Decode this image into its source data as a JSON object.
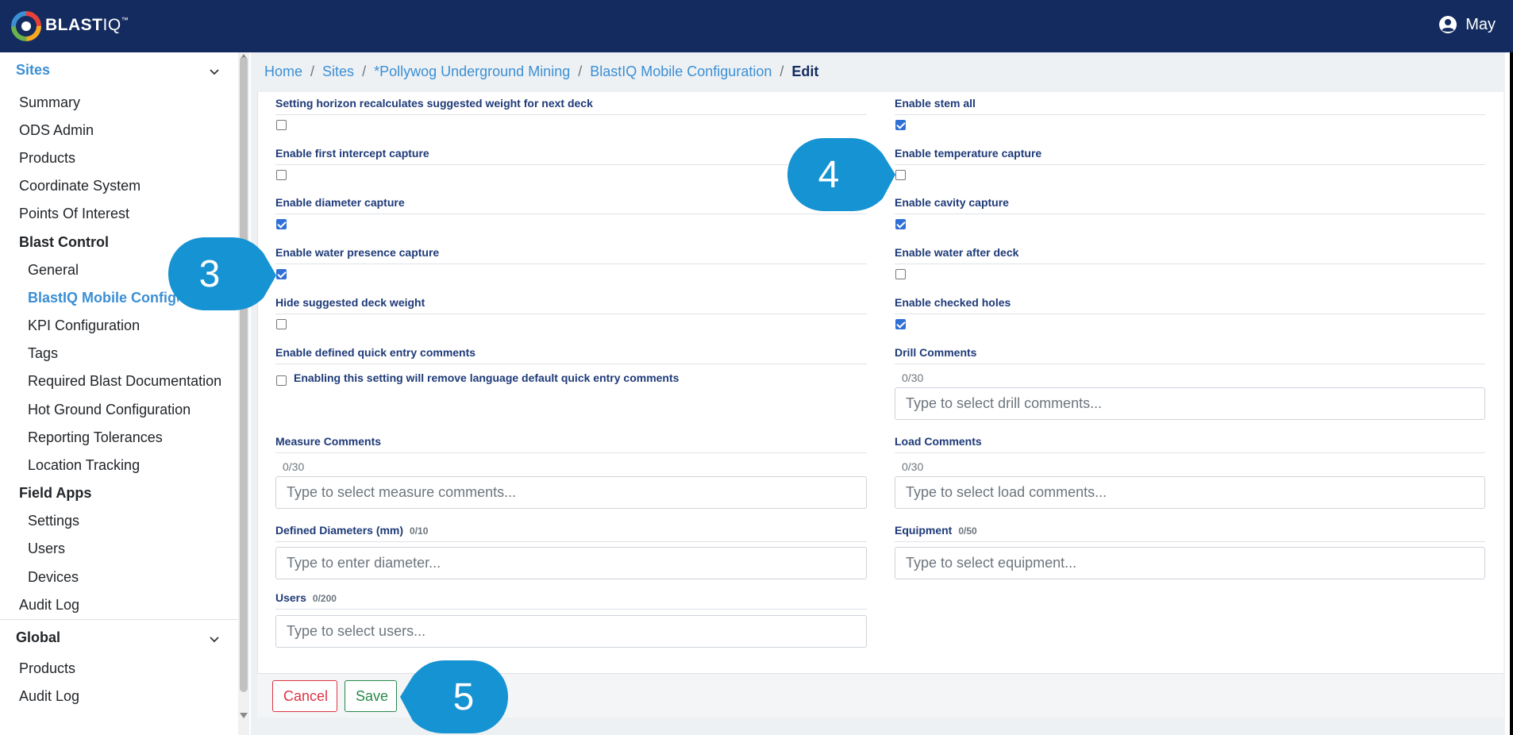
{
  "header": {
    "brand_bold": "BLAST",
    "brand_light": "IQ",
    "brand_tm": "™",
    "user_name": "May"
  },
  "sidebar": {
    "sites_title": "Sites",
    "sites_items": [
      "Summary",
      "ODS Admin",
      "Products",
      "Coordinate System",
      "Points Of Interest"
    ],
    "blast_control": "Blast Control",
    "blast_items": [
      "General",
      "BlastIQ Mobile Configuration",
      "KPI Configuration",
      "Tags",
      "Required Blast Documentation",
      "Hot Ground Configuration",
      "Reporting Tolerances",
      "Location Tracking"
    ],
    "field_apps": "Field Apps",
    "field_items": [
      "Settings",
      "Users",
      "Devices"
    ],
    "audit_log": "Audit Log",
    "global_title": "Global",
    "global_items": [
      "Products",
      "Audit Log"
    ]
  },
  "breadcrumb": [
    "Home",
    "Sites",
    "*Pollywog Underground Mining",
    "BlastIQ Mobile Configuration",
    "Edit"
  ],
  "form": {
    "left": {
      "horizon_label": "Setting horizon recalculates suggested weight for next deck",
      "horizon_checked": false,
      "first_intercept_label": "Enable first intercept capture",
      "first_intercept_checked": false,
      "diameter_label": "Enable diameter capture",
      "diameter_checked": true,
      "water_presence_label": "Enable water presence capture",
      "water_presence_checked": true,
      "hide_deck_label": "Hide suggested deck weight",
      "hide_deck_checked": false,
      "quick_entry_label": "Enable defined quick entry comments",
      "quick_entry_desc": "Enabling this setting will remove language default quick entry comments",
      "quick_entry_checked": false,
      "measure_label": "Measure Comments",
      "measure_counter": "0/30",
      "measure_placeholder": "Type to select measure comments...",
      "diameters_label": "Defined Diameters (mm)",
      "diameters_counter": "0/10",
      "diameters_placeholder": "Type to enter diameter...",
      "users_label": "Users",
      "users_counter": "0/200",
      "users_placeholder": "Type to select users..."
    },
    "right": {
      "stem_all_label": "Enable stem all",
      "stem_all_checked": true,
      "temperature_label": "Enable temperature capture",
      "temperature_checked": false,
      "cavity_label": "Enable cavity capture",
      "cavity_checked": true,
      "water_after_label": "Enable water after deck",
      "water_after_checked": false,
      "checked_holes_label": "Enable checked holes",
      "checked_holes_checked": true,
      "drill_label": "Drill Comments",
      "drill_counter": "0/30",
      "drill_placeholder": "Type to select drill comments...",
      "load_label": "Load Comments",
      "load_counter": "0/30",
      "load_placeholder": "Type to select load comments...",
      "equipment_label": "Equipment",
      "equipment_counter": "0/50",
      "equipment_placeholder": "Type to select equipment..."
    }
  },
  "footer": {
    "cancel_label": "Cancel",
    "save_label": "Save"
  },
  "callouts": {
    "three": "3",
    "four": "4",
    "five": "5"
  },
  "colors": {
    "header_bg": "#142b5f",
    "accent": "#3b8fd4",
    "callout": "#1693d2",
    "danger": "#dc3545",
    "success": "#28884a"
  }
}
